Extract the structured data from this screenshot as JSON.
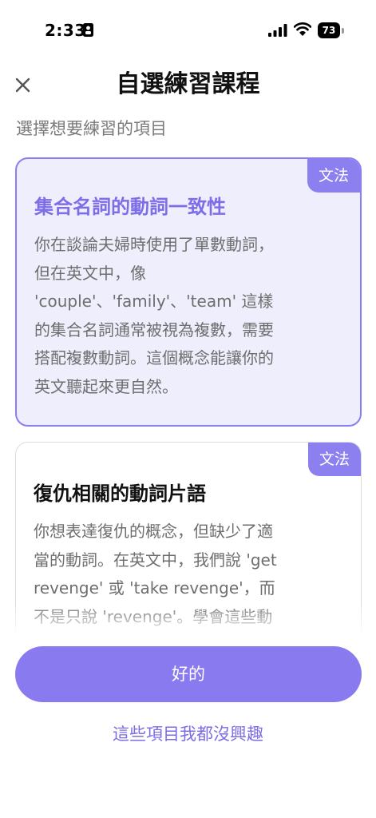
{
  "status_bar": {
    "time": "2:33",
    "battery": "73"
  },
  "header": {
    "title": "自選練習課程",
    "subtitle": "選擇想要練習的項目"
  },
  "cards": [
    {
      "tag": "文法",
      "title": "集合名詞的動詞一致性",
      "body_lines": [
        "你在談論夫婦時使用了單數動詞，",
        "但在英文中，像",
        "'couple'、'family'、'team' 這樣",
        "的集合名詞通常被視為複數，需要",
        "搭配複數動詞。這個概念能讓你的",
        "英文聽起來更自然。"
      ],
      "selected": true
    },
    {
      "tag": "文法",
      "title": "復仇相關的動詞片語",
      "body_lines": [
        "你想表達復仇的概念，但缺少了適",
        "當的動詞。在英文中，我們說 'get",
        "revenge' 或 'take revenge'，而",
        "不是只說 'revenge'。學會這些動"
      ],
      "selected": false
    }
  ],
  "actions": {
    "confirm_label": "好的",
    "dismiss_label": "這些項目我都沒興趣"
  },
  "colors": {
    "accent": "#8a7af0",
    "selected_card_bg": "#eeeefc",
    "selected_title": "#7d6ee8",
    "body_text": "#6e6e6e"
  },
  "icons": {
    "close": "close-icon",
    "lock": "lock-icon",
    "signal": "signal-icon",
    "wifi": "wifi-icon",
    "battery": "battery-icon"
  }
}
